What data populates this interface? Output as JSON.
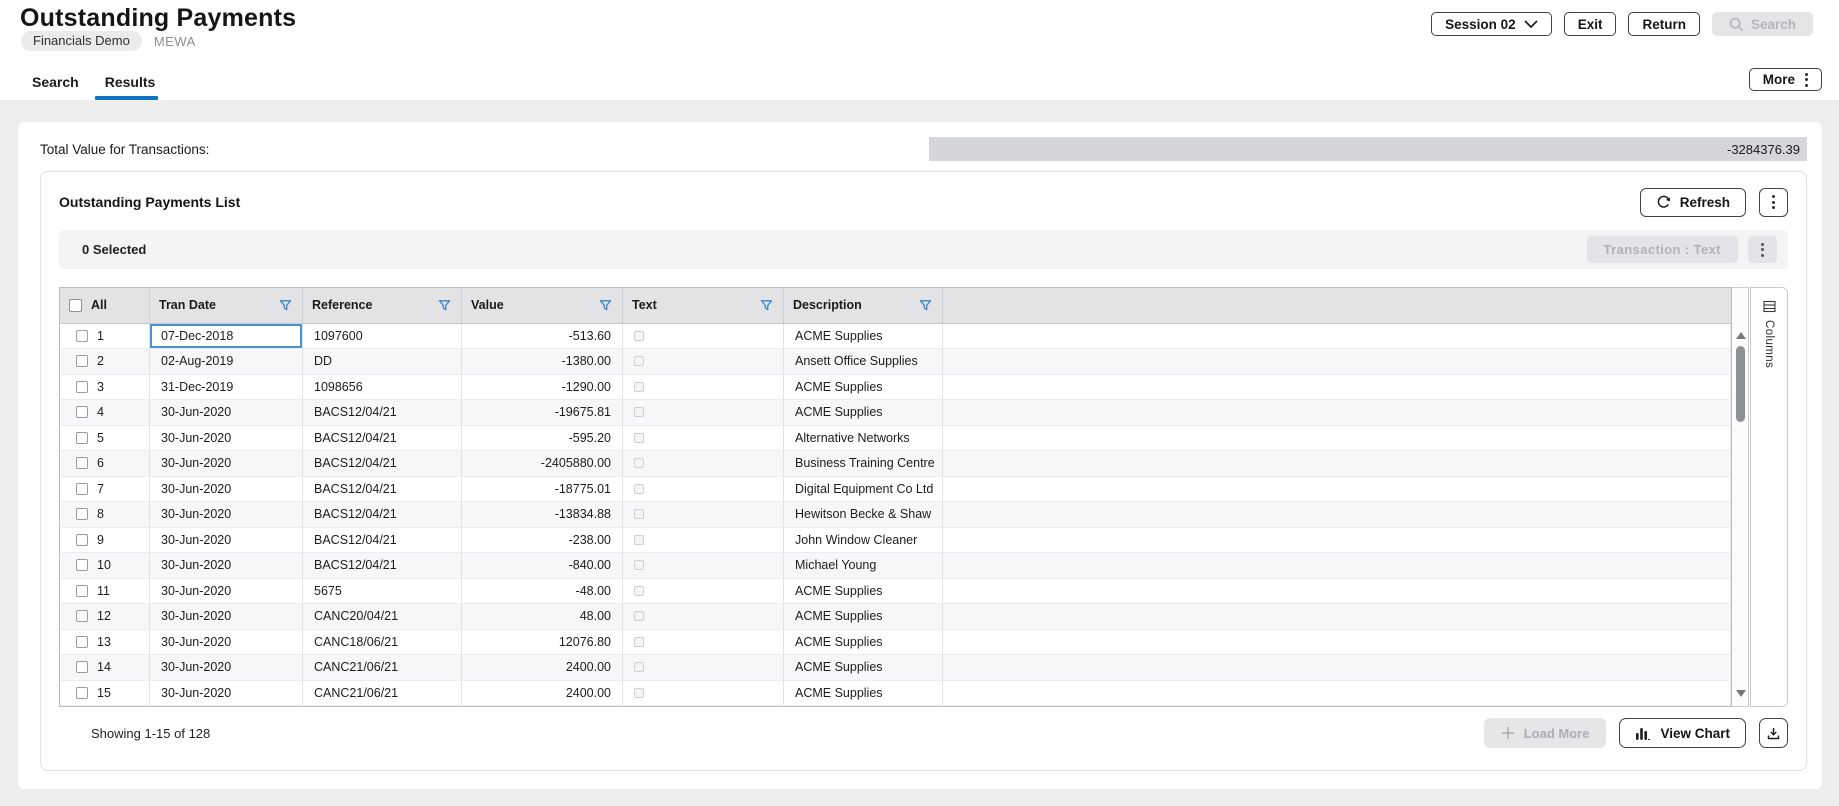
{
  "header": {
    "title": "Outstanding Payments",
    "breadcrumb_pill": "Financials Demo",
    "breadcrumb_env": "MEWA",
    "session_button": "Session 02",
    "exit_button": "Exit",
    "return_button": "Return",
    "search_button": "Search",
    "more_button": "More"
  },
  "tabs": [
    {
      "label": "Search",
      "active": false
    },
    {
      "label": "Results",
      "active": true
    }
  ],
  "totals": {
    "label": "Total Value for Transactions:",
    "value": "-3284376.39"
  },
  "list": {
    "title": "Outstanding Payments List",
    "refresh_button": "Refresh",
    "selected_count_label": "0 Selected",
    "transaction_text_button": "Transaction : Text",
    "columns_panel_label": "Columns",
    "table": {
      "select_all_label": "All",
      "columns": [
        "Tran Date",
        "Reference",
        "Value",
        "Text",
        "Description"
      ],
      "selected_cell": {
        "row": 1,
        "column": "Tran Date"
      },
      "rows": [
        {
          "num": "1",
          "tran_date": "07-Dec-2018",
          "reference": "1097600",
          "value": "-513.60",
          "text_checked": false,
          "description": "ACME Supplies"
        },
        {
          "num": "2",
          "tran_date": "02-Aug-2019",
          "reference": "DD",
          "value": "-1380.00",
          "text_checked": false,
          "description": "Ansett Office Supplies"
        },
        {
          "num": "3",
          "tran_date": "31-Dec-2019",
          "reference": "1098656",
          "value": "-1290.00",
          "text_checked": false,
          "description": "ACME Supplies"
        },
        {
          "num": "4",
          "tran_date": "30-Jun-2020",
          "reference": "BACS12/04/21",
          "value": "-19675.81",
          "text_checked": false,
          "description": "ACME Supplies"
        },
        {
          "num": "5",
          "tran_date": "30-Jun-2020",
          "reference": "BACS12/04/21",
          "value": "-595.20",
          "text_checked": false,
          "description": "Alternative Networks"
        },
        {
          "num": "6",
          "tran_date": "30-Jun-2020",
          "reference": "BACS12/04/21",
          "value": "-2405880.00",
          "text_checked": false,
          "description": "Business Training Centre"
        },
        {
          "num": "7",
          "tran_date": "30-Jun-2020",
          "reference": "BACS12/04/21",
          "value": "-18775.01",
          "text_checked": false,
          "description": "Digital Equipment Co Ltd"
        },
        {
          "num": "8",
          "tran_date": "30-Jun-2020",
          "reference": "BACS12/04/21",
          "value": "-13834.88",
          "text_checked": false,
          "description": "Hewitson Becke & Shaw"
        },
        {
          "num": "9",
          "tran_date": "30-Jun-2020",
          "reference": "BACS12/04/21",
          "value": "-238.00",
          "text_checked": false,
          "description": "John Window Cleaner"
        },
        {
          "num": "10",
          "tran_date": "30-Jun-2020",
          "reference": "BACS12/04/21",
          "value": "-840.00",
          "text_checked": false,
          "description": "Michael Young"
        },
        {
          "num": "11",
          "tran_date": "30-Jun-2020",
          "reference": "5675",
          "value": "-48.00",
          "text_checked": false,
          "description": "ACME Supplies"
        },
        {
          "num": "12",
          "tran_date": "30-Jun-2020",
          "reference": "CANC20/04/21",
          "value": "48.00",
          "text_checked": false,
          "description": "ACME Supplies"
        },
        {
          "num": "13",
          "tran_date": "30-Jun-2020",
          "reference": "CANC18/06/21",
          "value": "12076.80",
          "text_checked": false,
          "description": "ACME Supplies"
        },
        {
          "num": "14",
          "tran_date": "30-Jun-2020",
          "reference": "CANC21/06/21",
          "value": "2400.00",
          "text_checked": false,
          "description": "ACME Supplies"
        },
        {
          "num": "15",
          "tran_date": "30-Jun-2020",
          "reference": "CANC21/06/21",
          "value": "2400.00",
          "text_checked": false,
          "description": "ACME Supplies"
        }
      ]
    },
    "footer": {
      "showing": "Showing 1-15 of 128",
      "load_more_button": "Load More",
      "view_chart_button": "View Chart"
    }
  },
  "icons": {
    "session_dropdown": "chevron-down",
    "search_button": "magnifier",
    "more_button": "kebab-vertical",
    "refresh_button": "refresh-arrows",
    "list_menu": "kebab-vertical",
    "toolbar_menu": "kebab-vertical",
    "column_filter": "funnel",
    "columns_panel": "table-list",
    "load_more": "plus",
    "view_chart": "bar-chart",
    "download": "download-tray",
    "scroll_up": "triangle-up",
    "scroll_down": "triangle-down"
  },
  "colors": {
    "accent_blue": "#1173bd",
    "filter_blue": "#3987c8",
    "selected_cell_border": "#4a93d6",
    "total_bar_bg": "#d5d5dc",
    "page_bg": "#ededee",
    "disabled_bg": "#e4e4e8",
    "disabled_text": "#b2b2ba"
  }
}
